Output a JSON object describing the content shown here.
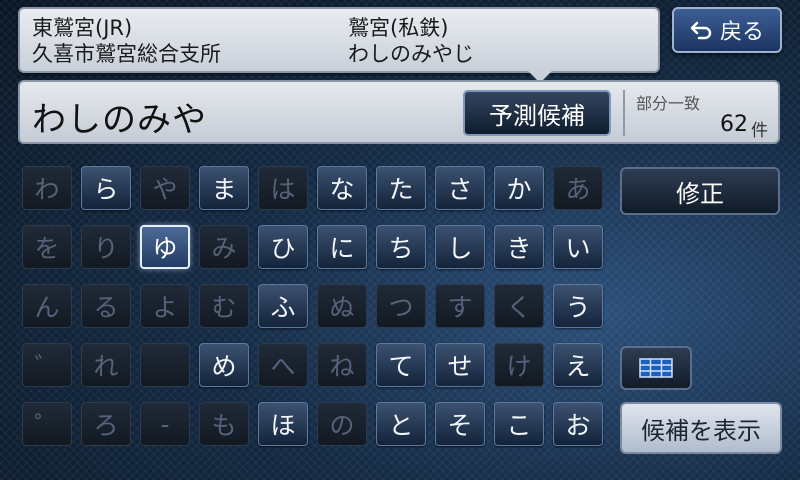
{
  "suggestions": [
    {
      "label": "東鷲宮(JR)"
    },
    {
      "label": "鷲宮(私鉄)"
    },
    {
      "label": "久喜市鷲宮総合支所"
    },
    {
      "label": "わしのみやじ"
    }
  ],
  "back_button": {
    "label": "戻る",
    "icon": "return-arrow-icon"
  },
  "input": {
    "text": "わしのみや",
    "predict_label": "予測候補",
    "match_label": "部分一致",
    "match_count": "62",
    "match_unit": "件"
  },
  "kana_rows": [
    [
      {
        "c": "わ",
        "s": "inactive"
      },
      {
        "c": "ら",
        "s": "active"
      },
      {
        "c": "や",
        "s": "inactive"
      },
      {
        "c": "ま",
        "s": "active"
      },
      {
        "c": "は",
        "s": "inactive"
      },
      {
        "c": "な",
        "s": "active"
      },
      {
        "c": "た",
        "s": "active"
      },
      {
        "c": "さ",
        "s": "active"
      },
      {
        "c": "か",
        "s": "active"
      },
      {
        "c": "あ",
        "s": "inactive"
      }
    ],
    [
      {
        "c": "を",
        "s": "inactive"
      },
      {
        "c": "り",
        "s": "inactive"
      },
      {
        "c": "ゆ",
        "s": "selected"
      },
      {
        "c": "み",
        "s": "inactive"
      },
      {
        "c": "ひ",
        "s": "active"
      },
      {
        "c": "に",
        "s": "active"
      },
      {
        "c": "ち",
        "s": "active"
      },
      {
        "c": "し",
        "s": "active"
      },
      {
        "c": "き",
        "s": "active"
      },
      {
        "c": "い",
        "s": "active"
      }
    ],
    [
      {
        "c": "ん",
        "s": "inactive"
      },
      {
        "c": "る",
        "s": "inactive"
      },
      {
        "c": "よ",
        "s": "inactive"
      },
      {
        "c": "む",
        "s": "inactive"
      },
      {
        "c": "ふ",
        "s": "active"
      },
      {
        "c": "ぬ",
        "s": "inactive"
      },
      {
        "c": "つ",
        "s": "inactive"
      },
      {
        "c": "す",
        "s": "inactive"
      },
      {
        "c": "く",
        "s": "inactive"
      },
      {
        "c": "う",
        "s": "active"
      }
    ],
    [
      {
        "c": "゛",
        "s": "inactive"
      },
      {
        "c": "れ",
        "s": "inactive"
      },
      {
        "c": "",
        "s": "inactive"
      },
      {
        "c": "め",
        "s": "active"
      },
      {
        "c": "へ",
        "s": "inactive"
      },
      {
        "c": "ね",
        "s": "inactive"
      },
      {
        "c": "て",
        "s": "active"
      },
      {
        "c": "せ",
        "s": "active"
      },
      {
        "c": "け",
        "s": "inactive"
      },
      {
        "c": "え",
        "s": "active"
      }
    ],
    [
      {
        "c": "゜",
        "s": "inactive"
      },
      {
        "c": "ろ",
        "s": "inactive"
      },
      {
        "c": "-",
        "s": "inactive"
      },
      {
        "c": "も",
        "s": "inactive"
      },
      {
        "c": "ほ",
        "s": "active"
      },
      {
        "c": "の",
        "s": "inactive"
      },
      {
        "c": "と",
        "s": "active"
      },
      {
        "c": "そ",
        "s": "active"
      },
      {
        "c": "こ",
        "s": "active"
      },
      {
        "c": "お",
        "s": "active"
      }
    ]
  ],
  "side": {
    "fix_label": "修正",
    "grid_icon": "list-grid-icon",
    "show_label": "候補を表示"
  }
}
